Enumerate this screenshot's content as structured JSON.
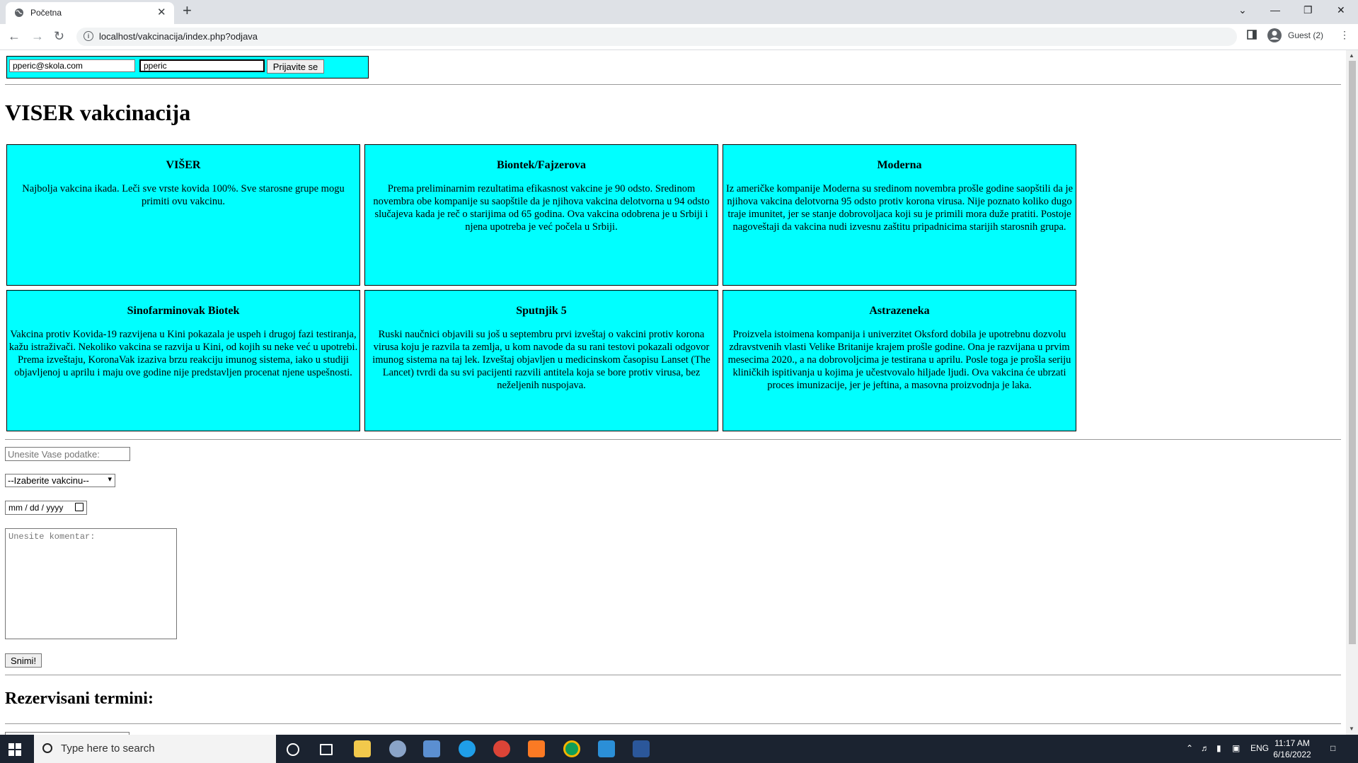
{
  "browser": {
    "tab_title": "Početna",
    "tab_close": "✕",
    "new_tab": "+",
    "url": "localhost/vakcinacija/index.php?odjava",
    "profile_label": "Guest (2)",
    "window_controls": {
      "minimize": "—",
      "restore": "❐",
      "close": "✕",
      "tab_search": "⌄"
    }
  },
  "login": {
    "email_value": "pperic@skola.com",
    "password_value": "pperic",
    "submit_label": "Prijavite se"
  },
  "page_title": "VISER vakcinacija",
  "vaccines": [
    {
      "name": "VIŠER",
      "description": "Najbolja vakcina ikada. Leči sve vrste kovida 100%. Sve starosne grupe mogu primiti ovu vakcinu."
    },
    {
      "name": "Biontek/Fajzerova",
      "description": "Prema preliminarnim rezultatima efikasnost vakcine je 90 odsto. Sredinom novembra obe kompanije su saopštile da je njihova vakcina delotvorna u 94 odsto slučajeva kada je reč o starijima od 65 godina. Ova vakcina odobrena je u Srbiji i njena upotreba je već počela u Srbiji."
    },
    {
      "name": "Moderna",
      "description": "Iz američke kompanije Moderna su sredinom novembra prošle godine saopštili da je njihova vakcina delotvorna 95 odsto protiv korona virusa. Nije poznato koliko dugo traje imunitet, jer se stanje dobrovoljaca koji su je primili mora duže pratiti. Postoje nagoveštaji da vakcina nudi izvesnu zaštitu pripadnicima starijih starosnih grupa."
    },
    {
      "name": "Sinofarminovak Biotek",
      "description": "Vakcina protiv Kovida-19 razvijena u Kini pokazala je uspeh i drugoj fazi testiranja, kažu istraživači. Nekoliko vakcina se razvija u Kini, od kojih su neke već u upotrebi. Prema izveštaju, KoronaVak izaziva brzu reakciju imunog sistema, iako u studiji objavljenoj u aprilu i maju ove godine nije predstavljen procenat njene uspešnosti."
    },
    {
      "name": "Sputnjik 5",
      "description": "Ruski naučnici objavili su još u septembru prvi izveštaj o vakcini protiv korona virusa koju je razvila ta zemlja, u kom navode da su rani testovi pokazali odgovor imunog sistema na taj lek. Izveštaj objavljen u medicinskom časopisu Lanset (The Lancet) tvrdi da su svi pacijenti razvili antitela koja se bore protiv virusa, bez neželjenih nuspojava."
    },
    {
      "name": "Astrazeneka",
      "description": "Proizvela istoimena kompanija i univerzitet Oksford dobila je upotrebnu dozvolu zdravstvenih vlasti Velike Britanije krajem prošle godine. Ona je razvijana u prvim mesecima 2020., a na dobrovoljcima je testirana u aprilu. Posle toga je prošla seriju kliničkih ispitivanja u kojima je učestvovalo hiljade ljudi. Ova vakcina će ubrzati proces imunizacije, jer je jeftina, a masovna proizvodnja je laka."
    }
  ],
  "form": {
    "data_placeholder": "Unesite Vase podatke:",
    "vaccine_select_value": "--Izaberite vakcinu--",
    "date_placeholder": "mm / dd / yyyy",
    "comment_placeholder": "Unesite komentar:",
    "save_label": "Snimi!"
  },
  "reserved_title": "Rezervisani termini:",
  "taskbar": {
    "search_placeholder": "Type here to search",
    "language": "ENG",
    "time": "11:17 AM",
    "date": "6/16/2022"
  },
  "colors": {
    "card_bg": "#00ffff",
    "taskbar_bg": "#1b2330"
  }
}
